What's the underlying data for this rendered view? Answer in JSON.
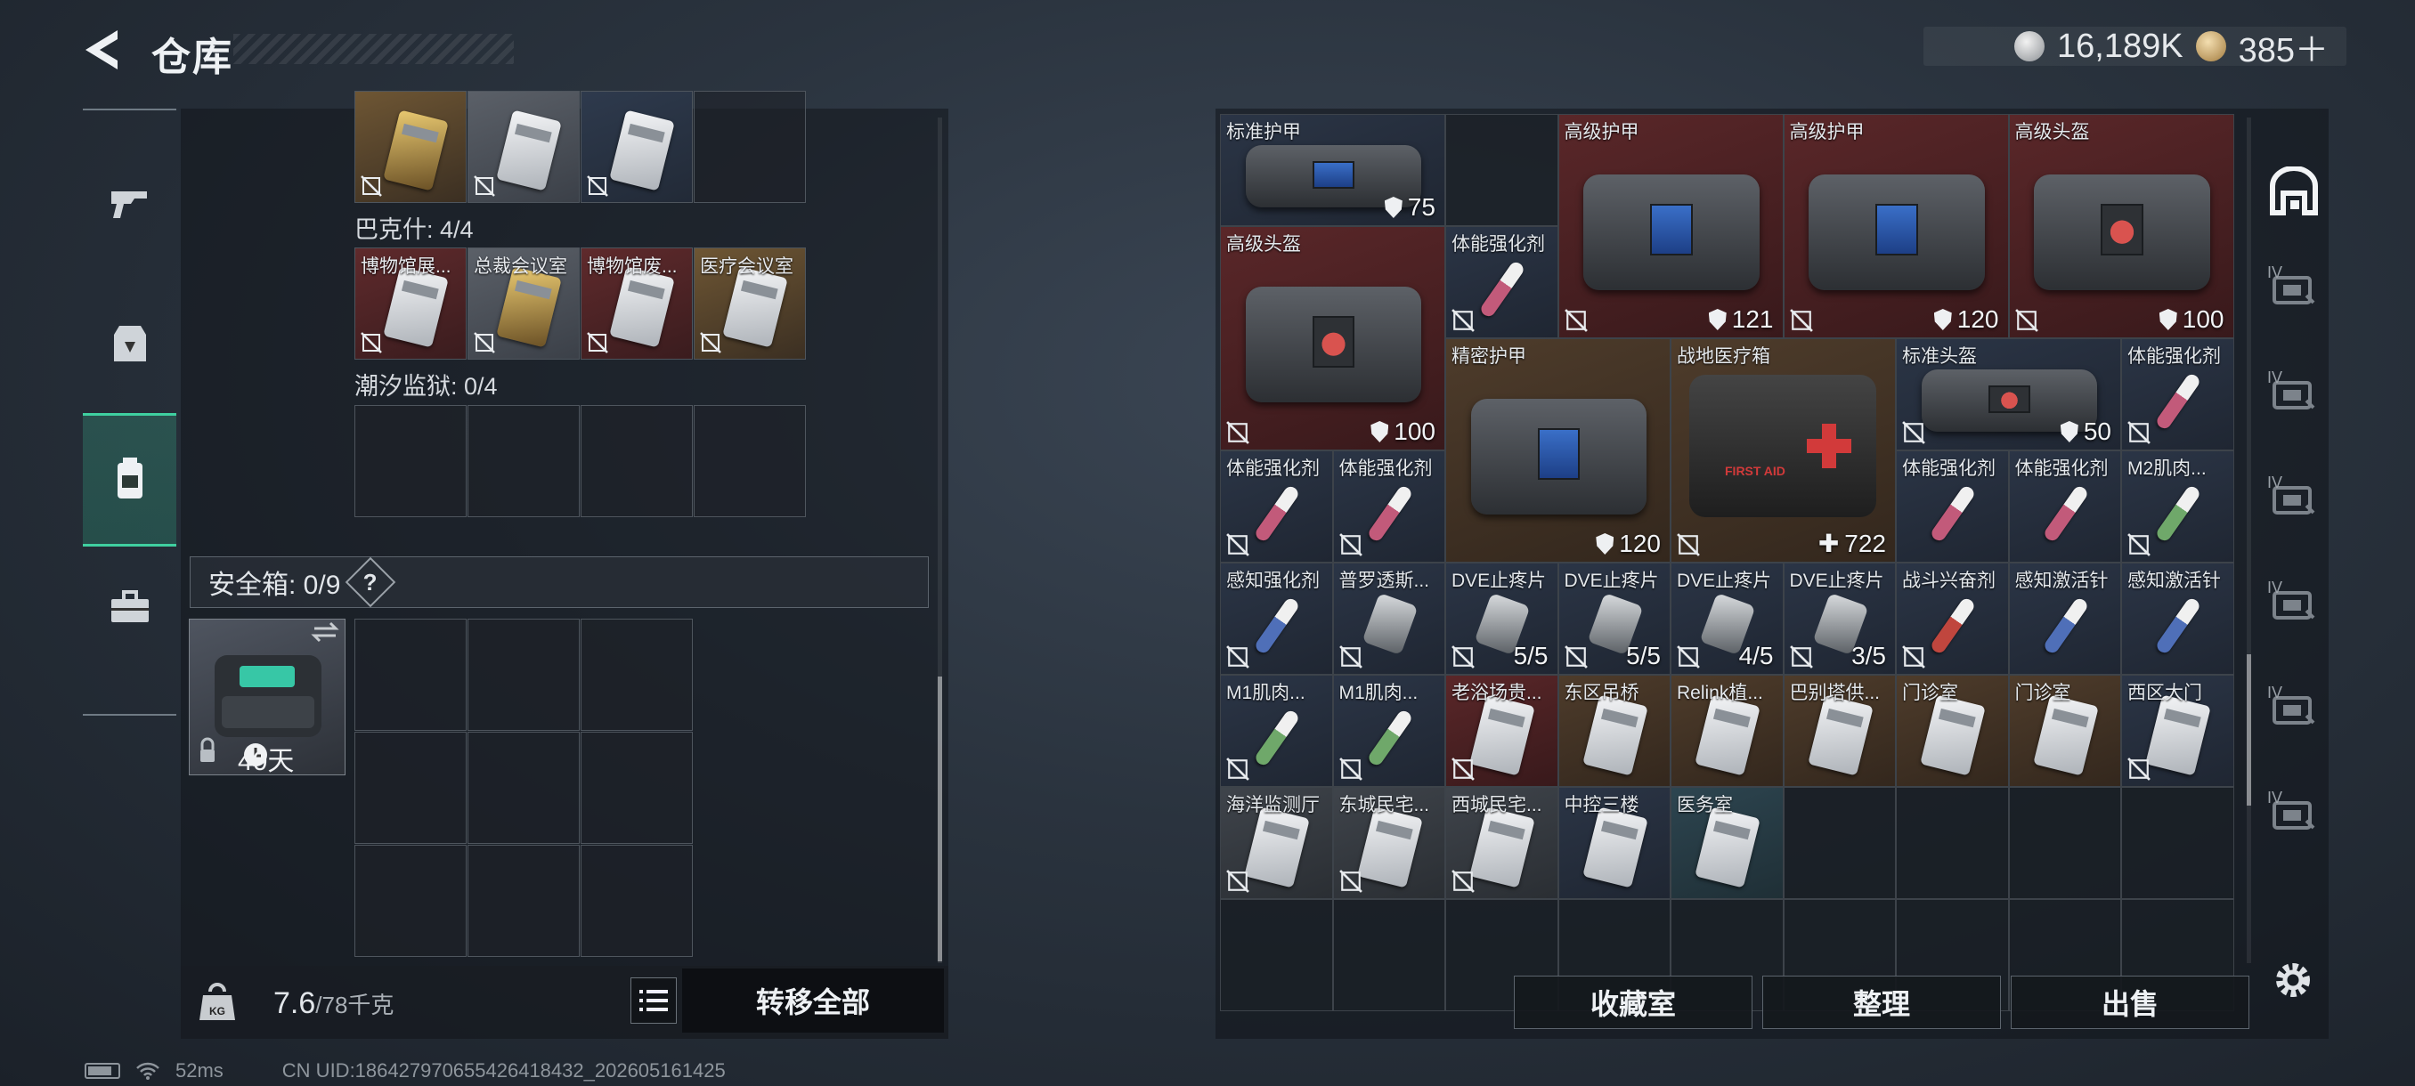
{
  "header": {
    "title": "仓库"
  },
  "currency": {
    "silver": "16,189K",
    "gold": "385＋"
  },
  "left_nav": [
    "gun-icon",
    "armor-icon",
    "backpack-icon",
    "toolbox-icon"
  ],
  "left_panel": {
    "top_row": [
      {
        "label": "",
        "color": "gold",
        "card": "gold"
      },
      {
        "label": "",
        "color": "grey",
        "card": "white"
      },
      {
        "label": "",
        "color": "blue",
        "card": "white"
      },
      {
        "label": "",
        "color": "empty",
        "card": ""
      }
    ],
    "section_bakeshi": "巴克什: 4/4",
    "bakeshi_items": [
      {
        "label": "博物馆展...",
        "color": "red",
        "card": "white"
      },
      {
        "label": "总裁会议室",
        "color": "grey",
        "card": "gold"
      },
      {
        "label": "博物馆废...",
        "color": "red",
        "card": "white"
      },
      {
        "label": "医疗会议室",
        "color": "gold",
        "card": "white"
      }
    ],
    "section_chaoxi": "潮汐监狱: 0/4",
    "safebox_title": "安全箱: 0/9",
    "safebox_help": "?",
    "safebox_days": "40天",
    "weight_value": "7.6",
    "weight_max": "/78千克",
    "transfer_label": "转移全部"
  },
  "right_panel": {
    "items": [
      {
        "label": "标准护甲",
        "val": "75",
        "type": "bag",
        "col": 0,
        "row": 0,
        "w": 2,
        "h": 1,
        "bg": "blue",
        "nolock": true
      },
      {
        "label": "高级护甲",
        "val": "121",
        "type": "bag",
        "col": 3,
        "row": 0,
        "w": 2,
        "h": 2,
        "bg": "red"
      },
      {
        "label": "高级护甲",
        "val": "120",
        "type": "bag",
        "col": 5,
        "row": 0,
        "w": 2,
        "h": 2,
        "bg": "red"
      },
      {
        "label": "高级头盔",
        "val": "100",
        "type": "bagred",
        "col": 7,
        "row": 0,
        "w": 2,
        "h": 2,
        "bg": "red"
      },
      {
        "label": "高级头盔",
        "val": "100",
        "type": "bagred",
        "col": 0,
        "row": 1,
        "w": 2,
        "h": 2,
        "bg": "red"
      },
      {
        "label": "体能强化剂",
        "val": "",
        "type": "syr-pink",
        "col": 2,
        "row": 1,
        "w": 1,
        "h": 1,
        "bg": "blue"
      },
      {
        "label": "精密护甲",
        "val": "120",
        "type": "bag",
        "col": 2,
        "row": 2,
        "w": 2,
        "h": 2,
        "bg": "brown",
        "nolock": true
      },
      {
        "label": "战地医疗箱",
        "val": "722",
        "type": "medkit",
        "col": 4,
        "row": 2,
        "w": 2,
        "h": 2,
        "bg": "brown",
        "plus": true
      },
      {
        "label": "标准头盔",
        "val": "50",
        "type": "bagred",
        "col": 6,
        "row": 2,
        "w": 2,
        "h": 1,
        "bg": "blue"
      },
      {
        "label": "体能强化剂",
        "val": "",
        "type": "syr-pink",
        "col": 8,
        "row": 2,
        "w": 1,
        "h": 1,
        "bg": "blue"
      },
      {
        "label": "体能强化剂",
        "val": "",
        "type": "syr-pink",
        "col": 0,
        "row": 3,
        "w": 1,
        "h": 1,
        "bg": "blue"
      },
      {
        "label": "体能强化剂",
        "val": "",
        "type": "syr-pink",
        "col": 1,
        "row": 3,
        "w": 1,
        "h": 1,
        "bg": "blue"
      },
      {
        "label": "体能强化剂",
        "val": "",
        "type": "syr-pink",
        "col": 6,
        "row": 3,
        "w": 1,
        "h": 1,
        "bg": "blue",
        "nolock": true
      },
      {
        "label": "体能强化剂",
        "val": "",
        "type": "syr-pink",
        "col": 7,
        "row": 3,
        "w": 1,
        "h": 1,
        "bg": "blue",
        "nolock": true
      },
      {
        "label": "M2肌肉...",
        "val": "",
        "type": "syr-green",
        "col": 8,
        "row": 3,
        "w": 1,
        "h": 1,
        "bg": "blue"
      },
      {
        "label": "感知强化剂",
        "val": "",
        "type": "syr-blue",
        "col": 0,
        "row": 4,
        "w": 1,
        "h": 1,
        "bg": "blue"
      },
      {
        "label": "普罗透斯...",
        "val": "",
        "type": "pill",
        "col": 1,
        "row": 4,
        "w": 1,
        "h": 1,
        "bg": "blue"
      },
      {
        "label": "DVE止疼片",
        "val": "5/5",
        "type": "pill",
        "col": 2,
        "row": 4,
        "w": 1,
        "h": 1,
        "bg": "blue"
      },
      {
        "label": "DVE止疼片",
        "val": "5/5",
        "type": "pill",
        "col": 3,
        "row": 4,
        "w": 1,
        "h": 1,
        "bg": "blue"
      },
      {
        "label": "DVE止疼片",
        "val": "4/5",
        "type": "pill",
        "col": 4,
        "row": 4,
        "w": 1,
        "h": 1,
        "bg": "blue"
      },
      {
        "label": "DVE止疼片",
        "val": "3/5",
        "type": "pill",
        "col": 5,
        "row": 4,
        "w": 1,
        "h": 1,
        "bg": "blue"
      },
      {
        "label": "战斗兴奋剂",
        "val": "",
        "type": "syr-red",
        "col": 6,
        "row": 4,
        "w": 1,
        "h": 1,
        "bg": "blue"
      },
      {
        "label": "感知激活针",
        "val": "",
        "type": "syr-blue",
        "col": 7,
        "row": 4,
        "w": 1,
        "h": 1,
        "bg": "blue",
        "nolock": true
      },
      {
        "label": "感知激活针",
        "val": "",
        "type": "syr-blue",
        "col": 8,
        "row": 4,
        "w": 1,
        "h": 1,
        "bg": "blue",
        "nolock": true
      },
      {
        "label": "M1肌肉...",
        "val": "",
        "type": "syr-green",
        "col": 0,
        "row": 5,
        "w": 1,
        "h": 1,
        "bg": "blue"
      },
      {
        "label": "M1肌肉...",
        "val": "",
        "type": "syr-green",
        "col": 1,
        "row": 5,
        "w": 1,
        "h": 1,
        "bg": "blue"
      },
      {
        "label": "老浴场贵...",
        "val": "",
        "type": "card",
        "col": 2,
        "row": 5,
        "w": 1,
        "h": 1,
        "bg": "red"
      },
      {
        "label": "东区吊桥",
        "val": "",
        "type": "card",
        "col": 3,
        "row": 5,
        "w": 1,
        "h": 1,
        "bg": "brown",
        "nolock": true
      },
      {
        "label": "Relink植...",
        "val": "",
        "type": "card",
        "col": 4,
        "row": 5,
        "w": 1,
        "h": 1,
        "bg": "brown",
        "nolock": true
      },
      {
        "label": "巴别塔供...",
        "val": "",
        "type": "card",
        "col": 5,
        "row": 5,
        "w": 1,
        "h": 1,
        "bg": "brown",
        "nolock": true
      },
      {
        "label": "门诊室",
        "val": "",
        "type": "card",
        "col": 6,
        "row": 5,
        "w": 1,
        "h": 1,
        "bg": "brown",
        "nolock": true
      },
      {
        "label": "门诊室",
        "val": "",
        "type": "card",
        "col": 7,
        "row": 5,
        "w": 1,
        "h": 1,
        "bg": "brown",
        "nolock": true
      },
      {
        "label": "西区大门",
        "val": "",
        "type": "card",
        "col": 8,
        "row": 5,
        "w": 1,
        "h": 1,
        "bg": "blue"
      },
      {
        "label": "海洋监测厅",
        "val": "",
        "type": "card",
        "col": 0,
        "row": 6,
        "w": 1,
        "h": 1,
        "bg": "grey"
      },
      {
        "label": "东城民宅...",
        "val": "",
        "type": "card",
        "col": 1,
        "row": 6,
        "w": 1,
        "h": 1,
        "bg": "grey"
      },
      {
        "label": "西城民宅...",
        "val": "",
        "type": "card",
        "col": 2,
        "row": 6,
        "w": 1,
        "h": 1,
        "bg": "grey"
      },
      {
        "label": "中控三楼",
        "val": "",
        "type": "card",
        "col": 3,
        "row": 6,
        "w": 1,
        "h": 1,
        "bg": "blue",
        "nolock": true
      },
      {
        "label": "医务室",
        "val": "",
        "type": "card",
        "col": 4,
        "row": 6,
        "w": 1,
        "h": 1,
        "bg": "teal",
        "nolock": true
      }
    ],
    "buttons": {
      "collection": "收藏室",
      "sort": "整理",
      "sell": "出售"
    }
  },
  "right_nav": {
    "tiers": [
      "IV",
      "IV",
      "IV",
      "IV",
      "IV",
      "IV"
    ]
  },
  "footer": {
    "ping": "52ms",
    "uid": "CN UID:186427970655426418432_202605161425"
  },
  "colors": {
    "accent_green": "#3fd0a0",
    "red_slot": "#5f2a2c",
    "gold_slot": "#6e5634",
    "blue_slot": "#2e3a4d"
  }
}
